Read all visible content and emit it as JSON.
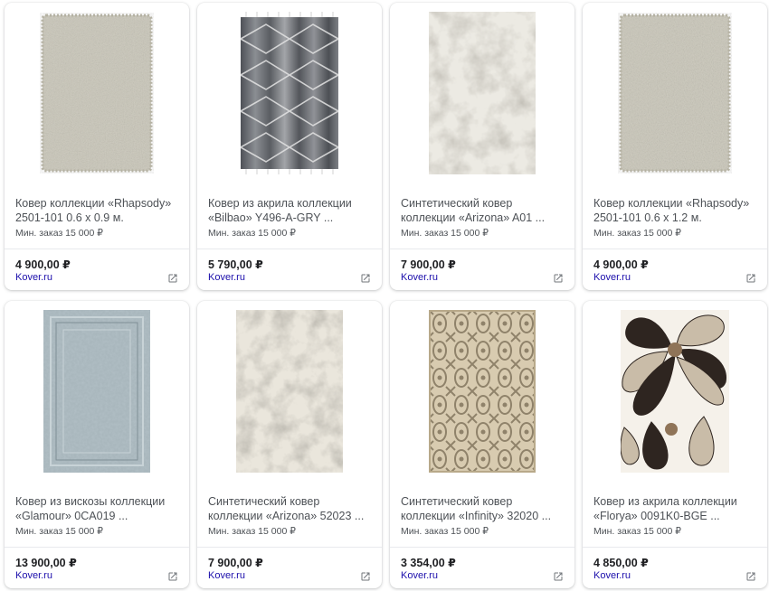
{
  "products": [
    {
      "title": "Ковер коллекции «Rhapsody» 2501-101 0.6 x 0.9 м.",
      "min_order": "Мин. заказ 15 000 ₽",
      "price": "4 900,00 ₽",
      "merchant": "Kover.ru",
      "icon": "open-in-new-icon",
      "rug_style": "shaggy",
      "colors": [
        "#c9c6b8",
        "#b5b2a3"
      ]
    },
    {
      "title": "Ковер из акрила коллекции «Bilbao» Y496-A-GRY ...",
      "min_order": "Мин. заказ 15 000 ₽",
      "price": "5 790,00 ₽",
      "merchant": "Kover.ru",
      "icon": "open-in-new-icon",
      "rug_style": "stripes-dark",
      "colors": [
        "#5b5d63",
        "#9fa1a6"
      ]
    },
    {
      "title": "Синтетический ковер коллекции «Arizona» A01 ...",
      "min_order": "Мин. заказ 15 000 ₽",
      "price": "7 900,00 ₽",
      "merchant": "Kover.ru",
      "icon": "open-in-new-icon",
      "rug_style": "abstract",
      "colors": [
        "#eceae3",
        "#a8a79f"
      ]
    },
    {
      "title": "Ковер коллекции «Rhapsody» 2501-101 0.6 x 1.2 м.",
      "min_order": "Мин. заказ 15 000 ₽",
      "price": "4 900,00 ₽",
      "merchant": "Kover.ru",
      "icon": "open-in-new-icon",
      "rug_style": "shaggy",
      "colors": [
        "#c9c6b8",
        "#b5b2a3"
      ]
    },
    {
      "title": "Ковер из вискозы коллекции «Glamour» 0CA019 ...",
      "min_order": "Мин. заказ 15 000 ₽",
      "price": "13 900,00 ₽",
      "merchant": "Kover.ru",
      "icon": "open-in-new-icon",
      "rug_style": "classic",
      "colors": [
        "#a9b7bd",
        "#7f8f96"
      ]
    },
    {
      "title": "Синтетический ковер коллекции «Arizona» 52023 ...",
      "min_order": "Мин. заказ 15 000 ₽",
      "price": "7 900,00 ₽",
      "merchant": "Kover.ru",
      "icon": "open-in-new-icon",
      "rug_style": "abstract",
      "colors": [
        "#eae6dc",
        "#9e9a8e"
      ]
    },
    {
      "title": "Синтетический ковер коллекции «Infinity» 32020 ...",
      "min_order": "Мин. заказ 15 000 ₽",
      "price": "3 354,00 ₽",
      "merchant": "Kover.ru",
      "icon": "open-in-new-icon",
      "rug_style": "damask",
      "colors": [
        "#d8cbb0",
        "#8f826a"
      ]
    },
    {
      "title": "Ковер из акрила коллекции «Florya» 0091K0-BGE ...",
      "min_order": "Мин. заказ 15 000 ₽",
      "price": "4 850,00 ₽",
      "merchant": "Kover.ru",
      "icon": "open-in-new-icon",
      "rug_style": "floral",
      "colors": [
        "#2e2520",
        "#c9bca8"
      ]
    }
  ]
}
